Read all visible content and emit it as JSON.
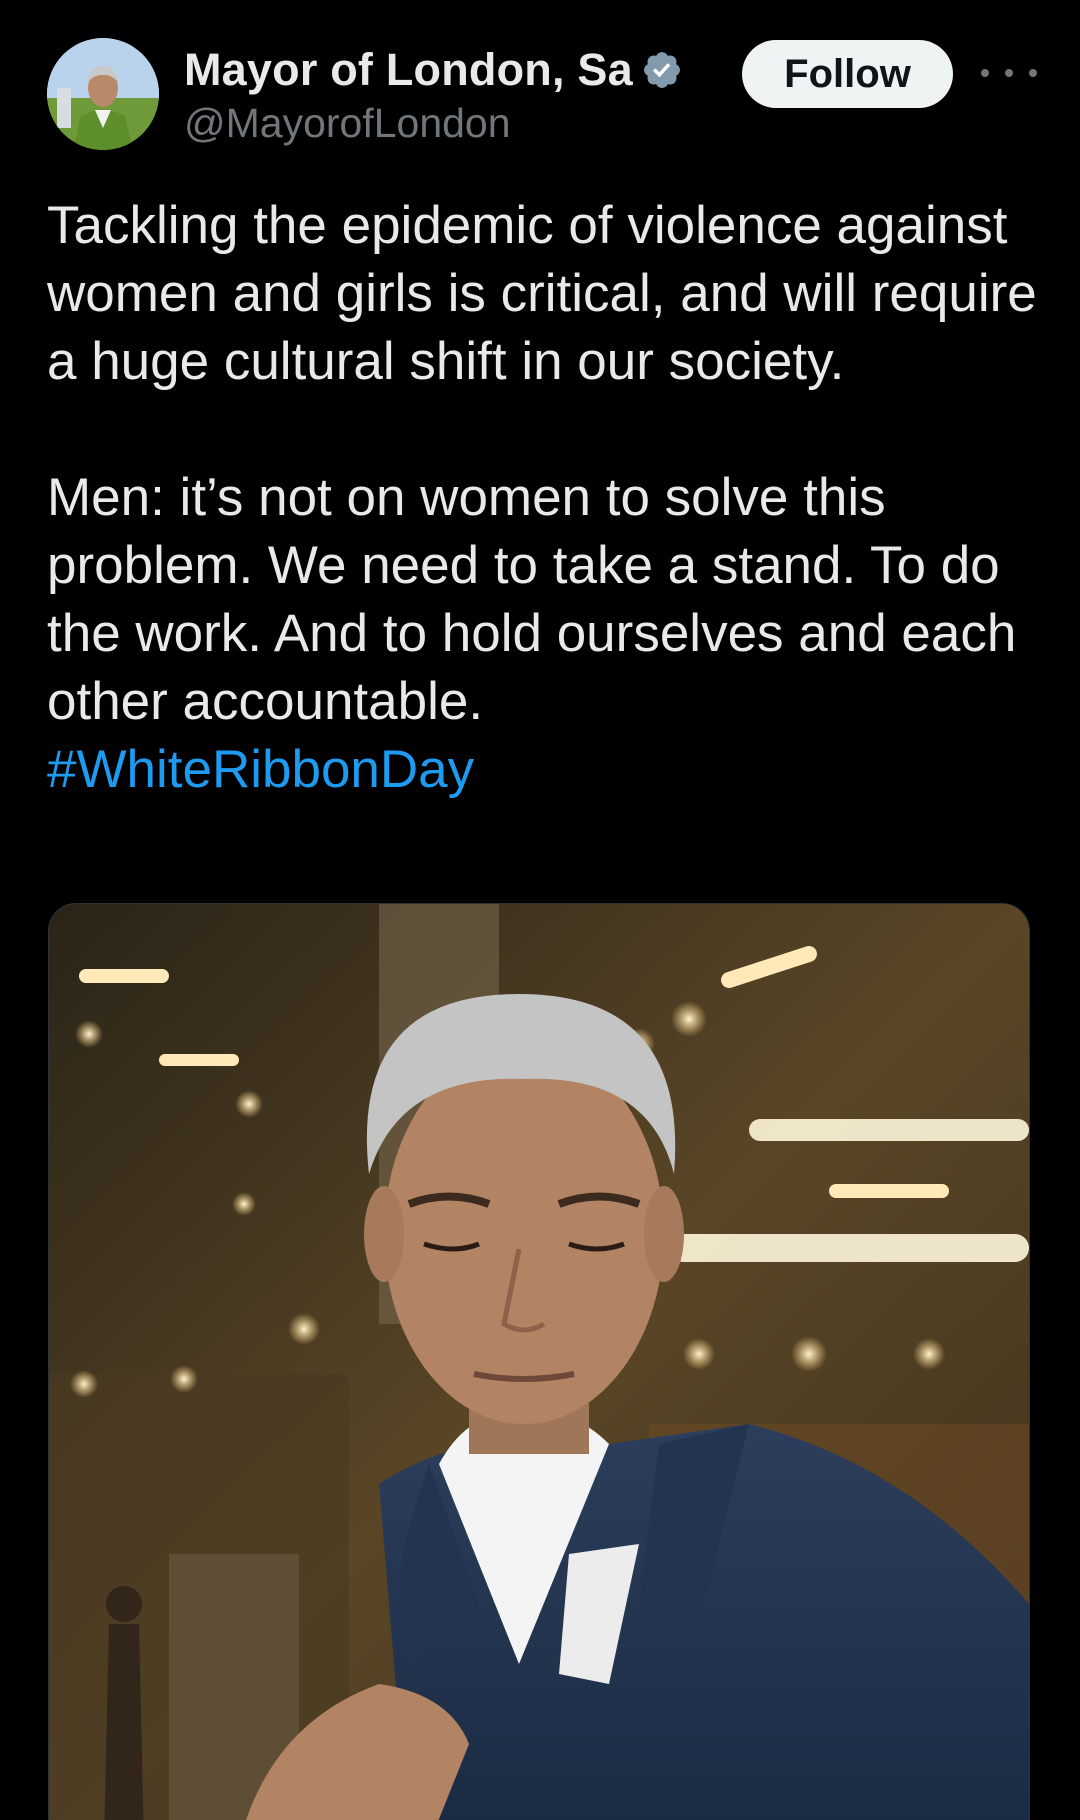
{
  "post": {
    "author": {
      "display_name": "Mayor of London, Sa",
      "handle": "@MayorofLondon",
      "avatar_icon": "profile-photo",
      "verified_icon": "verified-badge-icon"
    },
    "follow_label": "Follow",
    "more_icon": "more-options-icon",
    "text_paragraph_1": "Tackling the epidemic of violence against women and girls is critical, and will require a huge cultural shift in our society.",
    "text_paragraph_2": "Men: it’s not on women to solve this problem. We need to take a stand. To do the work. And to hold ourselves and each other accountable.",
    "hashtag": "#WhiteRibbonDay",
    "media": {
      "icon": "attached-photo"
    }
  },
  "colors": {
    "background": "#000000",
    "text": "#e7e9ea",
    "secondary_text": "#71767b",
    "link": "#1d9bf0",
    "verified": "#829aab",
    "follow_bg": "#eff3f4"
  }
}
